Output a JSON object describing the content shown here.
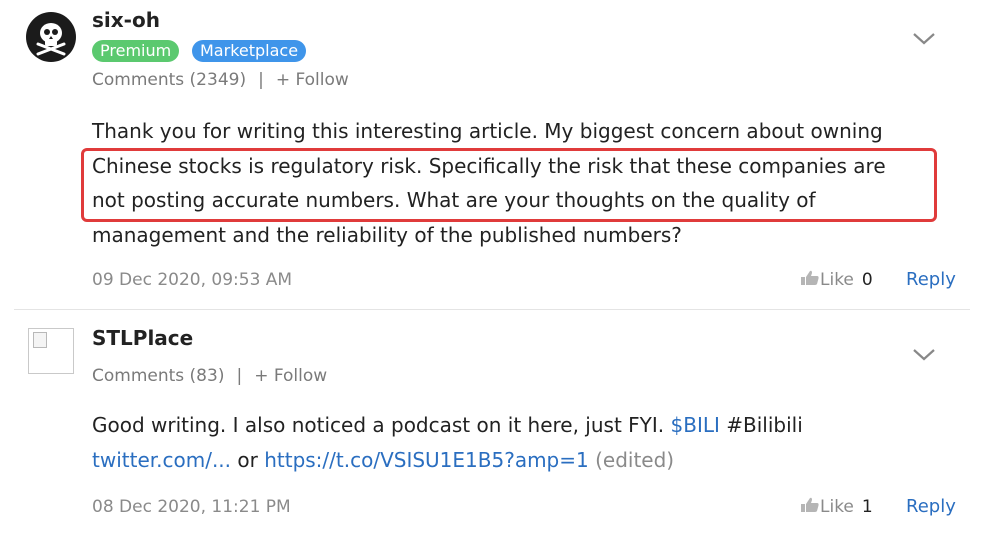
{
  "comments": [
    {
      "username": "six-oh",
      "avatar": "pirate-skull-flag-icon",
      "badges": [
        "Premium",
        "Marketplace"
      ],
      "meta": {
        "comments_label": "Comments (2349)",
        "separator": "|",
        "follow_label": "+ Follow"
      },
      "body_lines": [
        "Thank you for writing this interesting article. My biggest concern about owning",
        "Chinese stocks is regulatory risk. Specifically the risk that these companies are",
        "not posting accurate numbers. What are your thoughts on the quality of",
        "management and the reliability of the published numbers?"
      ],
      "timestamp": "09 Dec 2020, 09:53 AM",
      "like_label": "Like",
      "like_count": "0",
      "reply_label": "Reply",
      "highlight_color": "#e03b3b"
    },
    {
      "username": "STLPlace",
      "avatar": "broken-image-icon",
      "meta": {
        "comments_label": "Comments (83)",
        "separator": "|",
        "follow_label": "+ Follow"
      },
      "body_line1": {
        "text": "Good writing. I also noticed a podcast on it here, just FYI. ",
        "ticker": "$BILI",
        "tag": " #Bilibili"
      },
      "body_line2": {
        "link1": "twitter.com/...",
        "or": " or ",
        "link2": "https://t.co/VSISU1E1B5?amp=1",
        "edited": " (edited)"
      },
      "timestamp": "08 Dec 2020, 11:21 PM",
      "like_label": "Like",
      "like_count": "1",
      "reply_label": "Reply"
    }
  ],
  "colors": {
    "link": "#2a6ec0",
    "premium": "#5bc96f",
    "marketplace": "#3f95ea",
    "muted": "#7a7a7a"
  }
}
